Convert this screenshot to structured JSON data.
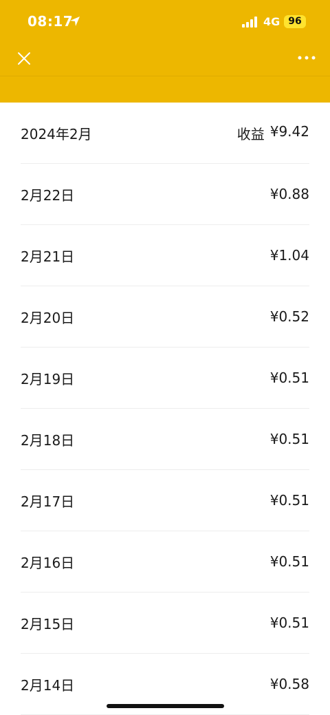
{
  "status_bar": {
    "time": "08:17",
    "network": "4G",
    "battery": "96"
  },
  "nav": {
    "close_icon": "close-icon",
    "more_icon": "more-icon"
  },
  "summary": {
    "month": "2024年2月",
    "label": "收益",
    "amount": "¥9.42"
  },
  "rows": [
    {
      "date": "2月22日",
      "amount": "¥0.88"
    },
    {
      "date": "2月21日",
      "amount": "¥1.04"
    },
    {
      "date": "2月20日",
      "amount": "¥0.52"
    },
    {
      "date": "2月19日",
      "amount": "¥0.51"
    },
    {
      "date": "2月18日",
      "amount": "¥0.51"
    },
    {
      "date": "2月17日",
      "amount": "¥0.51"
    },
    {
      "date": "2月16日",
      "amount": "¥0.51"
    },
    {
      "date": "2月15日",
      "amount": "¥0.51"
    },
    {
      "date": "2月14日",
      "amount": "¥0.58"
    }
  ],
  "colors": {
    "header": "#EDB700",
    "battery_badge": "#FFE32F"
  }
}
